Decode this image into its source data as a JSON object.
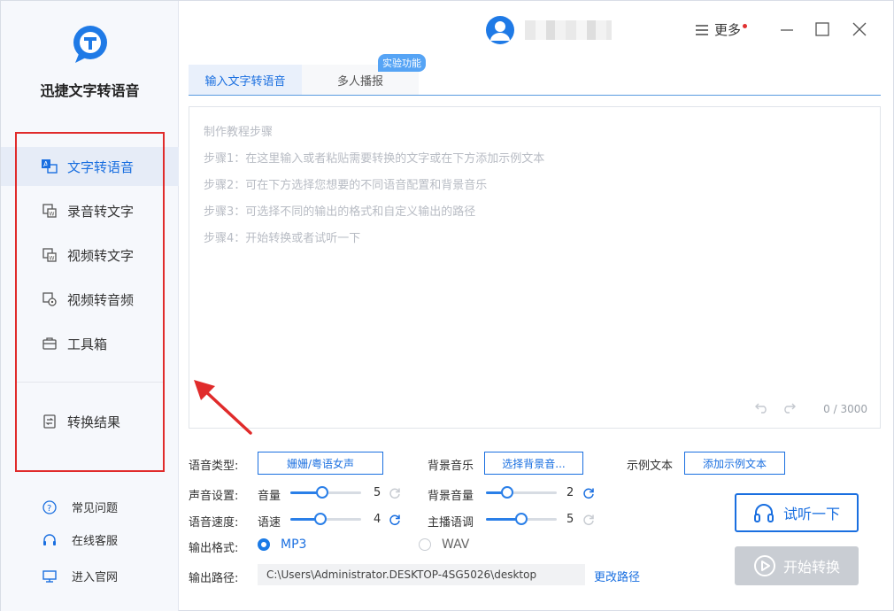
{
  "app": {
    "name": "迅捷文字转语音",
    "more_label": "更多"
  },
  "sidebar": {
    "items": [
      {
        "label": "文字转语音",
        "icon": "text-to-speech-icon",
        "active": true
      },
      {
        "label": "录音转文字",
        "icon": "recording-to-text-icon"
      },
      {
        "label": "视频转文字",
        "icon": "video-to-text-icon"
      },
      {
        "label": "视频转音频",
        "icon": "video-to-audio-icon"
      },
      {
        "label": "工具箱",
        "icon": "toolbox-icon"
      }
    ],
    "result": {
      "label": "转换结果",
      "icon": "result-icon"
    },
    "help": [
      {
        "label": "常见问题",
        "icon": "question-icon"
      },
      {
        "label": "在线客服",
        "icon": "headset-icon"
      },
      {
        "label": "进入官网",
        "icon": "monitor-icon"
      }
    ]
  },
  "tabs": [
    {
      "label": "输入文字转语音",
      "active": true
    },
    {
      "label": "多人播报"
    }
  ],
  "badge": "实验功能",
  "editor": {
    "guide": [
      "制作教程步骤",
      "步骤1：在这里输入或者粘贴需要转换的文字或在下方添加示例文本",
      "步骤2：可在下方选择您想要的不同语音配置和背景音乐",
      "步骤3：可选择不同的输出的格式和自定义输出的路径",
      "步骤4：开始转换或者试听一下"
    ],
    "counter": "0 / 3000"
  },
  "settings": {
    "voice_type_label": "语音类型:",
    "voice_type_value": "姗姗/粤语女声",
    "bgm_label": "背景音乐",
    "bgm_button": "选择背景音...",
    "sample_label": "示例文本",
    "sample_button": "添加示例文本",
    "sound_label": "声音设置:",
    "volume_label": "音量",
    "volume_value": "5",
    "volume_level": 0.45,
    "bg_volume_label": "背景音量",
    "bg_volume_value": "2",
    "bg_volume_level": 0.3,
    "speed_row_label": "语音速度:",
    "speed_label": "语速",
    "speed_value": "4",
    "speed_level": 0.42,
    "pitch_label": "主播语调",
    "pitch_value": "5",
    "pitch_level": 0.5,
    "format_label": "输出格式:",
    "format_mp3": "MP3",
    "format_wav": "WAV",
    "path_label": "输出路径:",
    "path_value": "C:\\Users\\Administrator.DESKTOP-4SG5026\\desktop",
    "change_path": "更改路径"
  },
  "actions": {
    "listen": "试听一下",
    "start": "开始转换"
  },
  "colors": {
    "accent": "#1a6fe0",
    "annotation": "#e02b2b",
    "disabled": "#c9cdd3"
  }
}
